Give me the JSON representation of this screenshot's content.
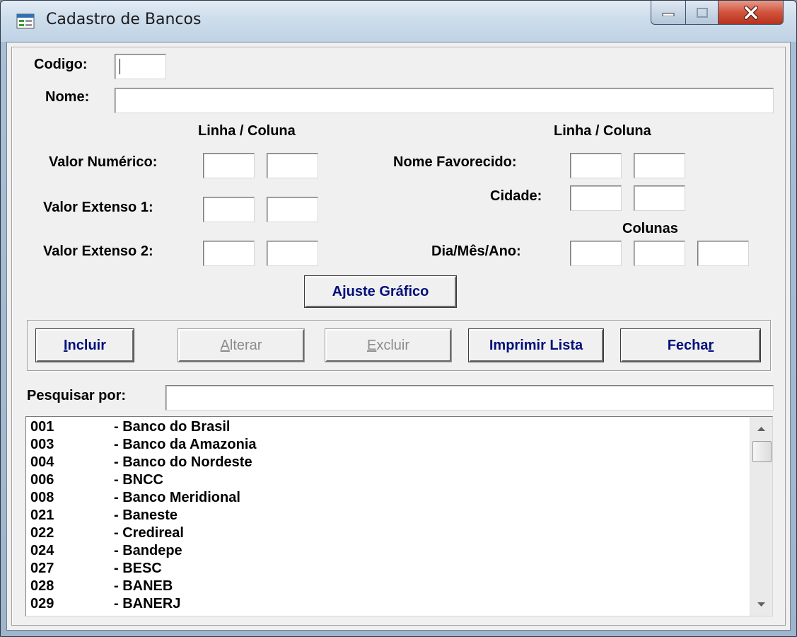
{
  "window": {
    "title": "Cadastro de Bancos",
    "controls": {
      "minimize": "—",
      "maximize": "□",
      "close": "✕"
    }
  },
  "form": {
    "codigo_label": "Codigo:",
    "codigo_value": "",
    "nome_label": "Nome:",
    "nome_value": "",
    "linha_coluna_left": "Linha / Coluna",
    "linha_coluna_right": "Linha / Coluna",
    "colunas_label": "Colunas",
    "valor_numerico_label": "Valor Numérico:",
    "valor_extenso1_label": "Valor Extenso 1:",
    "valor_extenso2_label": "Valor Extenso 2:",
    "nome_favorecido_label": "Nome Favorecido:",
    "cidade_label": "Cidade:",
    "dia_mes_ano_label": "Dia/Mês/Ano:",
    "ajuste_grafico_label": "Ajuste Gráfico"
  },
  "actions": {
    "incluir": {
      "pre": "",
      "key": "I",
      "post": "ncluir",
      "enabled": true
    },
    "alterar": {
      "pre": "",
      "key": "A",
      "post": "lterar",
      "enabled": false
    },
    "excluir": {
      "pre": "",
      "key": "E",
      "post": "xcluir",
      "enabled": false
    },
    "imprimir": {
      "label": "Imprimir Lista",
      "enabled": true
    },
    "fechar": {
      "pre": "Fecha",
      "key": "r",
      "post": "",
      "enabled": true
    }
  },
  "search": {
    "label": "Pesquisar por:",
    "value": ""
  },
  "bank_list": [
    {
      "code": "001",
      "name": "- Banco do Brasil"
    },
    {
      "code": "003",
      "name": "- Banco da Amazonia"
    },
    {
      "code": "004",
      "name": "- Banco do Nordeste"
    },
    {
      "code": "006",
      "name": "- BNCC"
    },
    {
      "code": "008",
      "name": "- Banco Meridional"
    },
    {
      "code": "021",
      "name": "- Baneste"
    },
    {
      "code": "022",
      "name": "- Credireal"
    },
    {
      "code": "024",
      "name": "- Bandepe"
    },
    {
      "code": "027",
      "name": "- BESC"
    },
    {
      "code": "028",
      "name": "- BANEB"
    },
    {
      "code": "029",
      "name": "- BANERJ"
    }
  ],
  "colors": {
    "button_text": "#000f7a",
    "disabled_text": "#8c8c8c",
    "dialog_bg": "#f0f0f0",
    "close_button": "#c8412b"
  }
}
